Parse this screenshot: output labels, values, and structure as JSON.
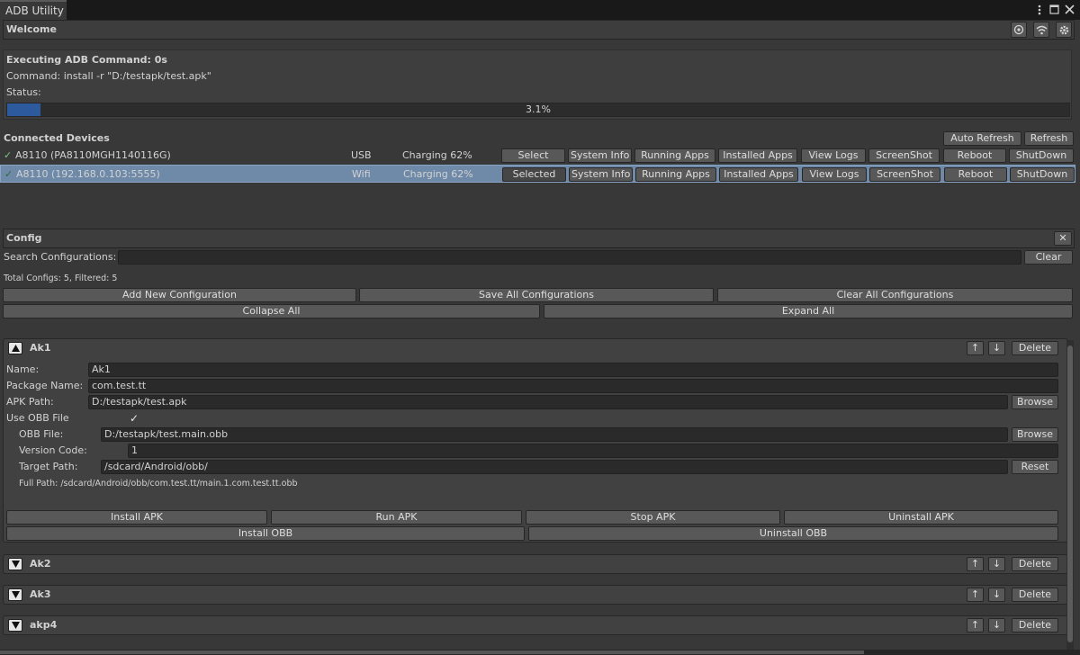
{
  "window": {
    "tab_title": "ADB Utility"
  },
  "welcome": {
    "title": "Welcome"
  },
  "exec": {
    "title": "Executing ADB Command: 0s",
    "command": "Command: install -r \"D:/testapk/test.apk\"",
    "status_label": "Status:",
    "progress_text": "3.1%",
    "progress_value": 0.031
  },
  "devices": {
    "title": "Connected Devices",
    "auto_refresh_label": "Auto Refresh",
    "refresh_label": "Refresh",
    "actions": [
      "System Info",
      "Running Apps",
      "Installed Apps",
      "View Logs",
      "ScreenShot",
      "Reboot",
      "ShutDown"
    ],
    "rows": [
      {
        "check": "✓",
        "name": "A8110 (PA8110MGH1140116G)",
        "conn": "USB",
        "battery": "Charging 62%",
        "select_label": "Select",
        "selected": false
      },
      {
        "check": "✓",
        "name": "A8110 (192.168.0.103:5555)",
        "conn": "Wifi",
        "battery": "Charging 62%",
        "select_label": "Selected",
        "selected": true
      }
    ]
  },
  "config": {
    "title": "Config",
    "close_symbol": "✕",
    "search_label": "Search Configurations:",
    "search_value": "",
    "clear_label": "Clear",
    "total_text": "Total Configs: 5, Filtered: 5",
    "add_label": "Add New Configuration",
    "save_all_label": "Save All Configurations",
    "clear_all_label": "Clear All Configurations",
    "collapse_all_label": "Collapse All",
    "expand_all_label": "Expand All",
    "up_symbol": "↑",
    "down_symbol": "↓",
    "delete_label": "Delete",
    "browse_label": "Browse",
    "reset_label": "Reset",
    "expanded": {
      "title": "Ak1",
      "name_label": "Name:",
      "name_value": "Ak1",
      "package_label": "Package Name:",
      "package_value": "com.test.tt",
      "apk_label": "APK Path:",
      "apk_value": "D:/testapk/test.apk",
      "use_obb_label": "Use OBB File",
      "use_obb_checked": true,
      "check_symbol": "✓",
      "obb_label": "OBB File:",
      "obb_value": "D:/testapk/test.main.obb",
      "version_label": "Version Code:",
      "version_value": "1",
      "target_label": "Target Path:",
      "target_value": "/sdcard/Android/obb/",
      "full_path": "Full Path: /sdcard/Android/obb/com.test.tt/main.1.com.test.tt.obb",
      "install_apk_label": "Install APK",
      "run_apk_label": "Run APK",
      "stop_apk_label": "Stop APK",
      "uninstall_apk_label": "Uninstall APK",
      "install_obb_label": "Install OBB",
      "uninstall_obb_label": "Uninstall OBB"
    },
    "collapsed": [
      {
        "title": "Ak2"
      },
      {
        "title": "Ak3"
      },
      {
        "title": "akp4"
      }
    ]
  },
  "colors": {
    "background": "#383838",
    "progress_fill": "#2d5a9c",
    "selected_row": "#6e8aa8"
  },
  "icons": [
    "menu-dots-icon",
    "maximize-icon",
    "close-icon",
    "target-icon",
    "wifi-icon",
    "gear-icon",
    "triangle-up-icon",
    "triangle-down-icon",
    "check-icon"
  ]
}
